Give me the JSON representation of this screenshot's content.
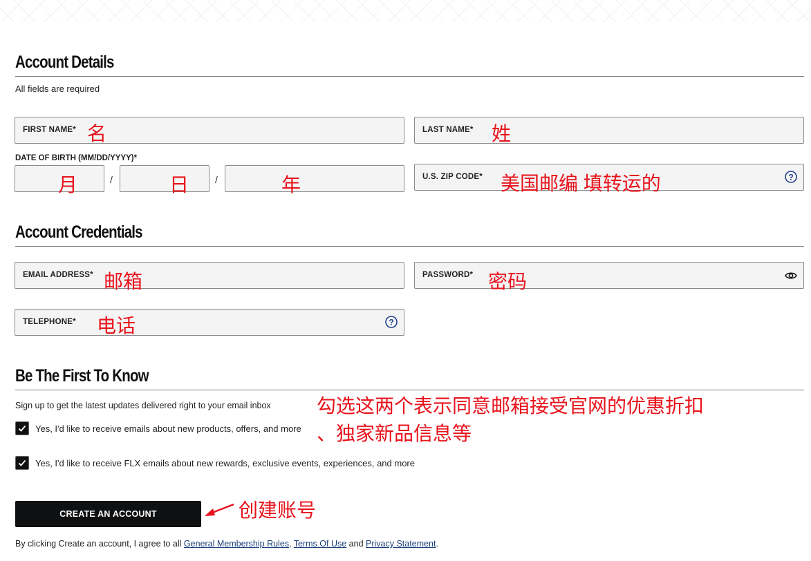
{
  "sections": {
    "account_details": {
      "title": "Account Details",
      "subtitle": "All fields are required"
    },
    "account_credentials": {
      "title": "Account Credentials"
    },
    "be_first": {
      "title": "Be The First To Know",
      "subtitle": "Sign up to get the latest updates delivered right to your email inbox"
    }
  },
  "fields": {
    "first_name": {
      "label": "FIRST NAME*",
      "value": "名"
    },
    "last_name": {
      "label": "LAST NAME*",
      "value": "姓"
    },
    "dob": {
      "label": "DATE OF BIRTH (MM/DD/YYYY)*",
      "separator": "/",
      "month": "月",
      "day": "日",
      "year": "年"
    },
    "zip": {
      "label": "U.S. ZIP CODE*",
      "value": "美国邮编 填转运的",
      "icon": "help-circle-icon"
    },
    "email": {
      "label": "EMAIL ADDRESS*",
      "value": "邮箱"
    },
    "password": {
      "label": "PASSWORD*",
      "value": "密码",
      "icon": "eye-icon"
    },
    "telephone": {
      "label": "TELEPHONE*",
      "value": "电话",
      "icon": "help-circle-icon"
    }
  },
  "checkboxes": [
    {
      "label": "Yes, I'd like to receive emails about new products, offers, and more",
      "checked": true
    },
    {
      "label": "Yes, I'd like to receive FLX emails about new rewards, exclusive events, experiences, and more",
      "checked": true
    }
  ],
  "annotations": {
    "checkbox_note_line1": "勾选这两个表示同意邮箱接受官网的优惠折扣",
    "checkbox_note_line2": "、独家新品信息等",
    "create_note": "创建账号"
  },
  "create_button": {
    "label": "CREATE AN ACCOUNT"
  },
  "legal": {
    "prefix": "By clicking Create an account, I agree to all ",
    "link1": "General Membership Rules",
    "sep1": ", ",
    "link2": "Terms Of Use",
    "sep2": " and ",
    "link3": "Privacy Statement",
    "suffix": "."
  },
  "colors": {
    "annotation_red": "#e8121b",
    "button_bg": "#0f1011",
    "link_blue": "#1a3f7a",
    "field_bg": "#f4f4f4",
    "icon_blue": "#1f3f8f"
  }
}
